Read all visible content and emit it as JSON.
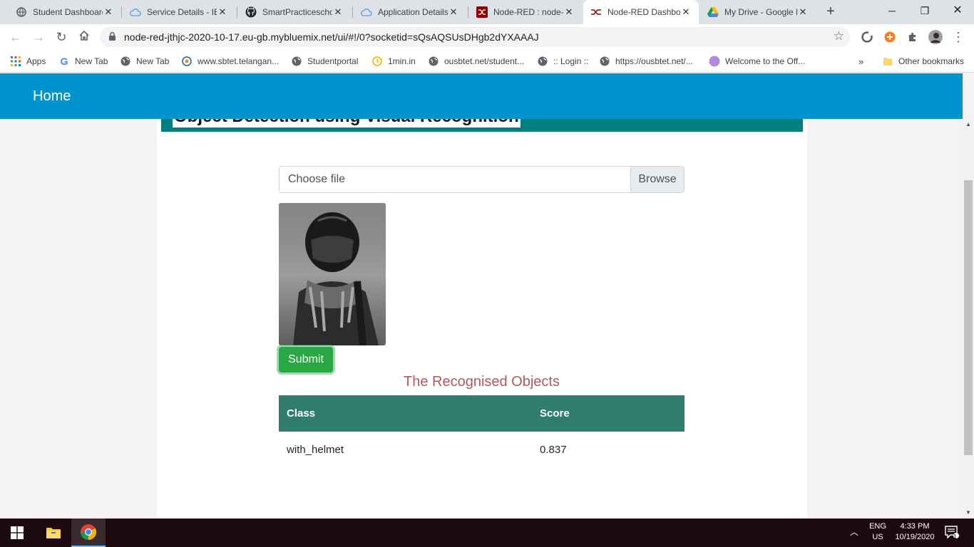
{
  "browser": {
    "tabs": [
      {
        "title": "Student Dashboard",
        "icon": "globe-icon",
        "active": false
      },
      {
        "title": "Service Details - IBM",
        "icon": "cloud-icon",
        "active": false
      },
      {
        "title": "SmartPracticeschool",
        "icon": "github-icon",
        "active": false
      },
      {
        "title": "Application Details",
        "icon": "cloud-icon",
        "active": false
      },
      {
        "title": "Node-RED : node-red",
        "icon": "node-red-icon",
        "active": false
      },
      {
        "title": "Node-RED Dashboard",
        "icon": "node-red-icon",
        "active": true
      },
      {
        "title": "My Drive - Google Drive",
        "icon": "google-drive-icon",
        "active": false
      }
    ],
    "url": "node-red-jthjc-2020-10-17.eu-gb.mybluemix.net/ui/#!/0?socketid=sQsAQSUsDHgb2dYXAAAJ",
    "bookmarks": [
      {
        "label": "Apps",
        "icon": "apps-grid-icon"
      },
      {
        "label": "New Tab",
        "icon": "google-icon"
      },
      {
        "label": "New Tab",
        "icon": "globe-icon"
      },
      {
        "label": "www.sbtet.telangan...",
        "icon": "seal-icon"
      },
      {
        "label": "Studentportal",
        "icon": "globe-icon"
      },
      {
        "label": "1min.in",
        "icon": "clock-icon"
      },
      {
        "label": "ousbtet.net/student...",
        "icon": "globe-icon"
      },
      {
        "label": ":: Login ::",
        "icon": "globe-icon"
      },
      {
        "label": "https://ousbtet.net/...",
        "icon": "globe-icon"
      },
      {
        "label": "Welcome to the Off...",
        "icon": "purple-circle-icon"
      }
    ],
    "bookmarks_overflow": "»",
    "other_bookmarks": "Other bookmarks"
  },
  "page": {
    "header_title": "Home",
    "card_title": "Object Detection using Visual Recognition",
    "file_input": {
      "placeholder": "Choose file",
      "browse_label": "Browse"
    },
    "submit_label": "Submit",
    "results": {
      "title": "The Recognised Objects",
      "columns": [
        "Class",
        "Score"
      ],
      "rows": [
        {
          "class": "with_helmet",
          "score": "0.837"
        }
      ]
    }
  },
  "taskbar": {
    "lang_top": "ENG",
    "lang_bottom": "US",
    "time": "4:33 PM",
    "date": "10/19/2020",
    "notification_count": "1"
  },
  "colors": {
    "header": "#0094ce",
    "title_bar": "#008080",
    "table_header": "#2e7d6f",
    "submit": "#28a745",
    "results_title": "#b0595c"
  }
}
